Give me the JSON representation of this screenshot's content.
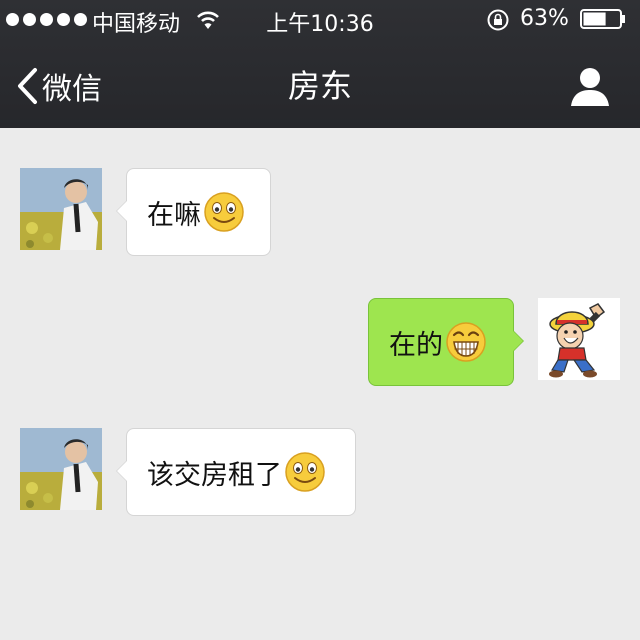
{
  "status_bar": {
    "carrier": "中国移动",
    "time": "上午10:36",
    "battery_pct": "63%",
    "signal_bars": 5,
    "battery_level": 0.63
  },
  "navbar": {
    "back_label": "微信",
    "title": "房东",
    "icons": {
      "back": "chevron-left-icon",
      "profile": "person-icon"
    }
  },
  "colors": {
    "navbar_bg": "#2b2c30",
    "chat_bg": "#ebebeb",
    "incoming_bubble": "#ffffff",
    "outgoing_bubble": "#9ee54f"
  },
  "messages": [
    {
      "direction": "incoming",
      "text": "在嘛",
      "emoji": "smile-emoji",
      "avatar": "landlord-avatar"
    },
    {
      "direction": "outgoing",
      "text": "在的",
      "emoji": "grin-emoji",
      "avatar": "own-avatar"
    },
    {
      "direction": "incoming",
      "text": "该交房租了",
      "emoji": "smile-emoji",
      "avatar": "landlord-avatar"
    }
  ]
}
